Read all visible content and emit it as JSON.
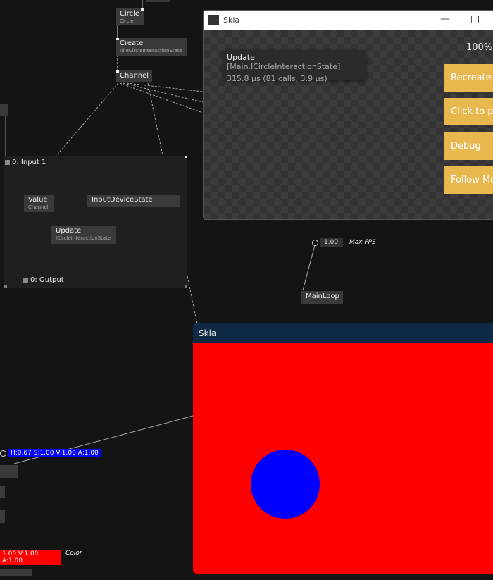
{
  "patch": {
    "circle_node": {
      "label": "Circle",
      "sub": "Circle"
    },
    "create_node": {
      "label": "Create",
      "sub": "IdleCircleInteractionState"
    },
    "channel_node": {
      "label": "Channel"
    },
    "input_label": "0:  Input 1",
    "output_label": "0:  Output",
    "value_node": {
      "label": "Value",
      "sub": "Channel"
    },
    "input_device_node": {
      "label": "InputDeviceState"
    },
    "update_node": {
      "label": "Update",
      "sub": "ICircleInteractionState"
    },
    "max_fps": {
      "value": "1.00",
      "label": "Max FPS"
    },
    "mainloop_node": {
      "label": "MainLoop"
    },
    "hsv_value": "H:0.67 S:1.00 V:1.00 A:1.00",
    "color_value": "1.00 V:1.00 A:1.00",
    "color_label": "Color",
    "colors": {
      "hsv_bg": "#0000ff",
      "color_bg": "#ff0000",
      "accent_orange": "#e8a020"
    }
  },
  "skia_window_1": {
    "title": "Skia",
    "zoom": "100%",
    "tooltip": {
      "title": "Update",
      "context": "[Main.ICircleInteractionState]",
      "stats": "315.8 µs (81 calls, 3.9 µs)"
    },
    "buttons": [
      "Recreate",
      "Click to p",
      "Debug",
      "Follow Mo"
    ],
    "button_color": "#e8b84f"
  },
  "skia_window_2": {
    "title": "Skia",
    "background": "#ff0000",
    "circle_color": "#0000ff"
  }
}
